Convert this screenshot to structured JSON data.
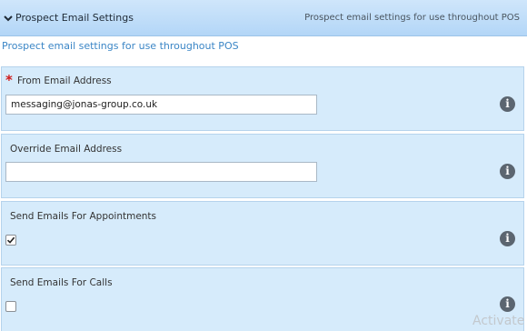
{
  "header": {
    "title": "Prospect Email Settings",
    "description": "Prospect email settings for use throughout POS"
  },
  "subdescription": "Prospect email settings for use throughout POS",
  "fields": {
    "from_email": {
      "required_marker": "*",
      "label": "From Email Address",
      "value": "messaging@jonas-group.co.uk"
    },
    "override_email": {
      "label": "Override Email Address",
      "value": ""
    },
    "send_appointments": {
      "label": "Send Emails For Appointments",
      "checked": true
    },
    "send_calls": {
      "label": "Send Emails For Calls",
      "checked": false
    }
  },
  "info_icon_glyph": "i",
  "watermark": "Activate",
  "colors": {
    "header_bg": "#c2def8",
    "section_bg": "#d6ebfb",
    "link_blue": "#3b86c6",
    "required_red": "#d01919",
    "info_icon": "#5b6570"
  }
}
